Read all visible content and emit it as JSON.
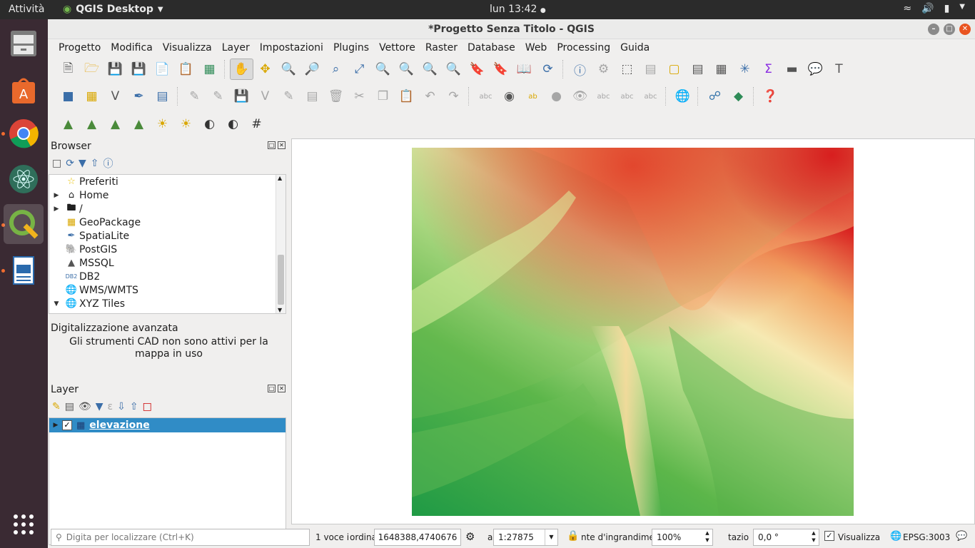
{
  "topbar": {
    "activities": "Attività",
    "app_name": "QGIS Desktop",
    "clock": "lun 13:42"
  },
  "window": {
    "title": "*Progetto Senza Titolo - QGIS"
  },
  "menubar": [
    "Progetto",
    "Modifica",
    "Visualizza",
    "Layer",
    "Impostazioni",
    "Plugins",
    "Vettore",
    "Raster",
    "Database",
    "Web",
    "Processing",
    "Guida"
  ],
  "browser": {
    "title": "Browser",
    "items": [
      {
        "label": "Preferiti",
        "icon": "star-icon",
        "expandable": false
      },
      {
        "label": "Home",
        "icon": "home-icon",
        "expandable": true
      },
      {
        "label": "/",
        "icon": "folder-icon",
        "expandable": true
      },
      {
        "label": "GeoPackage",
        "icon": "geopackage-icon",
        "expandable": false
      },
      {
        "label": "SpatiaLite",
        "icon": "spatialite-icon",
        "expandable": false
      },
      {
        "label": "PostGIS",
        "icon": "postgis-icon",
        "expandable": false
      },
      {
        "label": "MSSQL",
        "icon": "mssql-icon",
        "expandable": false
      },
      {
        "label": "DB2",
        "icon": "db2-icon",
        "expandable": false
      },
      {
        "label": "WMS/WMTS",
        "icon": "globe-icon",
        "expandable": false
      },
      {
        "label": "XYZ Tiles",
        "icon": "globe-icon",
        "expandable": true,
        "expanded": true
      }
    ]
  },
  "cad": {
    "title": "Digitalizzazione avanzata",
    "message": "Gli strumenti CAD non sono attivi per la mappa in uso"
  },
  "layers": {
    "title": "Layer",
    "items": [
      {
        "label": "elevazione",
        "checked": true
      }
    ]
  },
  "status": {
    "search_placeholder": "Digita per localizzare (Ctrl+K)",
    "legend_count": "1 voce i",
    "coord_label": "ordina",
    "coord_value": "1648388,4740676",
    "scale_label": "a",
    "scale_value": "1:27875",
    "magnifier_label": "nte d'ingrandimer",
    "magnifier_value": "100%",
    "rotation_label": "tazio",
    "rotation_value": "0,0 °",
    "render_label": "Visualizza",
    "crs": "EPSG:3003"
  }
}
